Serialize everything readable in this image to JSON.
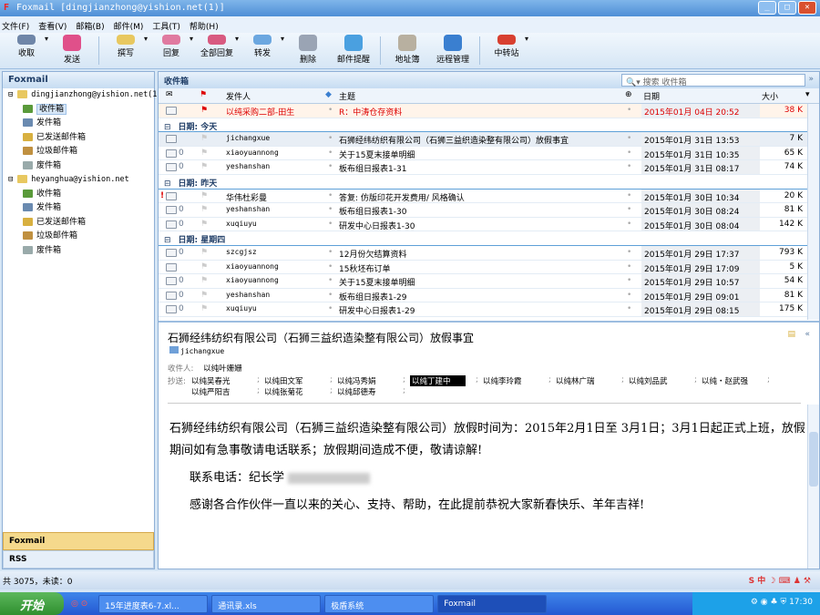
{
  "window": {
    "app_icon": "F",
    "title": "Foxmail [dingjianzhong@yishion.net(1)]"
  },
  "menu": [
    "文件(F)",
    "查看(V)",
    "邮箱(B)",
    "邮件(M)",
    "工具(T)",
    "帮助(H)"
  ],
  "toolbar": [
    {
      "label": "收取",
      "icon": "receive-icon",
      "color": "#6f86a8",
      "dd": true
    },
    {
      "label": "发送",
      "icon": "send-icon",
      "color": "#e0508a",
      "dd": false
    },
    {
      "label": "撰写",
      "icon": "compose-icon",
      "color": "#e8c860",
      "dd": true
    },
    {
      "label": "回复",
      "icon": "reply-icon",
      "color": "#e07aa0",
      "dd": true
    },
    {
      "label": "全部回复",
      "icon": "reply-all-icon",
      "color": "#d85a80",
      "dd": true
    },
    {
      "label": "转发",
      "icon": "forward-icon",
      "color": "#6ba7e0",
      "dd": true
    },
    {
      "label": "删除",
      "icon": "delete-icon",
      "color": "#9aa4b4",
      "dd": false
    },
    {
      "label": "邮件提醒",
      "icon": "reminder-icon",
      "color": "#4aa0e0",
      "dd": false
    },
    {
      "label": "地址簿",
      "icon": "address-book-icon",
      "color": "#b8b0a0",
      "dd": false
    },
    {
      "label": "远程管理",
      "icon": "remote-icon",
      "color": "#3a7fd0",
      "dd": false
    },
    {
      "label": "中转站",
      "icon": "transfer-station-icon",
      "color": "#d84030",
      "dd": true
    }
  ],
  "sidebar": {
    "title": "Foxmail",
    "accounts": [
      {
        "name": "dingjianzhong@yishion.net(1)",
        "folders": [
          "收件箱",
          "发件箱",
          "已发送邮件箱",
          "垃圾邮件箱",
          "废件箱"
        ]
      },
      {
        "name": "heyanghua@yishion.net",
        "folders": [
          "收件箱",
          "发件箱",
          "已发送邮件箱",
          "垃圾邮件箱",
          "废件箱"
        ]
      }
    ],
    "tabs": [
      "Foxmail",
      "RSS"
    ]
  },
  "list": {
    "title": "收件箱",
    "search_placeholder": "搜索 收件箱",
    "columns": {
      "sender": "发件人",
      "subject": "主题",
      "date": "日期",
      "size": "大小"
    },
    "pinned": {
      "sender": "以纯采购二部-田生",
      "subject": "R：中涛仓存资料",
      "date": "2015年01月 04日 20:52",
      "size": "38 K"
    },
    "groups": [
      {
        "label": "日期: 今天",
        "rows": [
          {
            "sender": "jichangxue",
            "subject": "石狮经纬纺织有限公司（石狮三益织造染整有限公司）放假事宜",
            "date": "2015年01月 31日 13:53",
            "size": "7 K",
            "att": false
          },
          {
            "sender": "xiaoyuannong",
            "subject": "关于15夏末接单明细",
            "date": "2015年01月 31日 10:35",
            "size": "65 K",
            "att": true
          },
          {
            "sender": "yeshanshan",
            "subject": "板布组日报表1-31",
            "date": "2015年01月 31日 08:17",
            "size": "74 K",
            "att": true
          }
        ]
      },
      {
        "label": "日期: 昨天",
        "rows": [
          {
            "sender": "华伟杜彩曼",
            "subject": "答复: 仿版印花开发费用/ 风格确认",
            "date": "2015年01月 30日 10:34",
            "size": "20 K",
            "att": false,
            "important": true
          },
          {
            "sender": "yeshanshan",
            "subject": "板布组日报表1-30",
            "date": "2015年01月 30日 08:24",
            "size": "81 K",
            "att": true
          },
          {
            "sender": "xuqiuyu",
            "subject": "研发中心日报表1-30",
            "date": "2015年01月 30日 08:04",
            "size": "142 K",
            "att": true
          }
        ]
      },
      {
        "label": "日期: 星期四",
        "rows": [
          {
            "sender": "szcgjsz",
            "subject": "12月份欠结算资料",
            "date": "2015年01月 29日 17:37",
            "size": "793 K",
            "att": true
          },
          {
            "sender": "xiaoyuannong",
            "subject": "15秋坯布订单",
            "date": "2015年01月 29日 17:09",
            "size": "5 K",
            "att": false
          },
          {
            "sender": "xiaoyuannong",
            "subject": "关于15夏末接单明细",
            "date": "2015年01月 29日 10:57",
            "size": "54 K",
            "att": true
          },
          {
            "sender": "yeshanshan",
            "subject": "板布组日报表1-29",
            "date": "2015年01月 29日 09:01",
            "size": "81 K",
            "att": true
          },
          {
            "sender": "xuqiuyu",
            "subject": "研发中心日报表1-29",
            "date": "2015年01月 29日 08:15",
            "size": "175 K",
            "att": true
          }
        ]
      }
    ]
  },
  "preview": {
    "subject": "石狮经纬纺织有限公司（石狮三益织造染整有限公司）放假事宜",
    "from": "jichangxue",
    "to_label": "收件人:",
    "to": "以纯叶姗姗",
    "cc_label": "抄送:",
    "cc": [
      "以纯吴春光",
      "以纯田文军",
      "以纯冯秀娟",
      "以纯丁建中",
      "以纯李玲霞",
      "以纯林广瑞",
      "以纯刘品武",
      "以纯・赵武强",
      "以纯严阳吉",
      "以纯张菊花",
      "以纯邱德寿"
    ],
    "body": [
      "石狮经纬纺织有限公司（石狮三益织造染整有限公司）放假时间为：2015年2月1日至 3月1日；3月1日起正式上班，放假期间如有急事敬请电话联系；放假期间造成不便，敬请谅解!",
      "联系电话：纪长学",
      "感谢各合作伙伴一直以来的关心、支持、帮助，在此提前恭祝大家新春快乐、羊年吉祥!"
    ]
  },
  "status": "共 3075，未读：0",
  "taskbar": {
    "start": "开始",
    "tasks": [
      "15年进度表6-7.xl...",
      "通讯录.xls",
      "极盾系统",
      "Foxmail"
    ],
    "clock": "17:30"
  }
}
